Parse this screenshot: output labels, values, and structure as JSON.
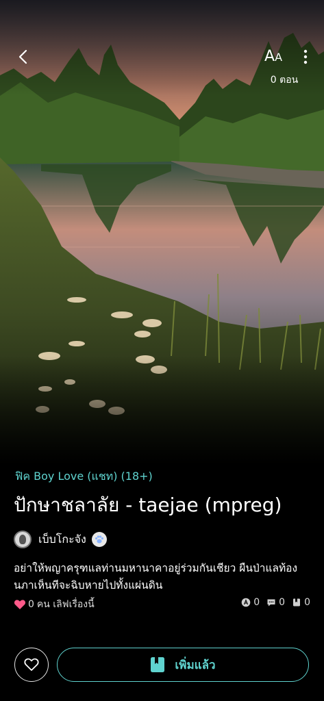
{
  "header": {
    "back_icon": "chevron-left-icon",
    "font_size_icon": "font-size-icon",
    "font_size_glyph": "A",
    "font_size_glyph_small": "A",
    "more_icon": "more-vertical-icon",
    "episode_count": "0 ตอน"
  },
  "story": {
    "category": "ฟิค Boy Love (แชท) (18+)",
    "title": "ปักษาชลาลัย - taejae (mpreg)",
    "author_name": "เบ็บโกะจัง",
    "author_badge_icon": "paw-icon",
    "synopsis": "อย่าให้พญาครุฑแลท่านมหานาคาอยู่ร่วมกันเชียว ผืนป่าแลท้องนภาเห็นทีจะฉิบหายไปทั้งแผ่นดิน",
    "likes_count": "0",
    "likes_label": "คน เลิฟเรื่องนี้",
    "stats": [
      {
        "icon": "comment-badge-icon",
        "value": "0"
      },
      {
        "icon": "chat-icon",
        "value": "0"
      },
      {
        "icon": "bookmark-icon",
        "value": "0"
      }
    ]
  },
  "actions": {
    "favorite_icon": "heart-outline-icon",
    "added_label": "เพิ่มแล้ว",
    "added_icon": "book-icon"
  },
  "colors": {
    "accent": "#5fd3cf",
    "like_heart": "#ff5a8a",
    "background": "#000000"
  }
}
